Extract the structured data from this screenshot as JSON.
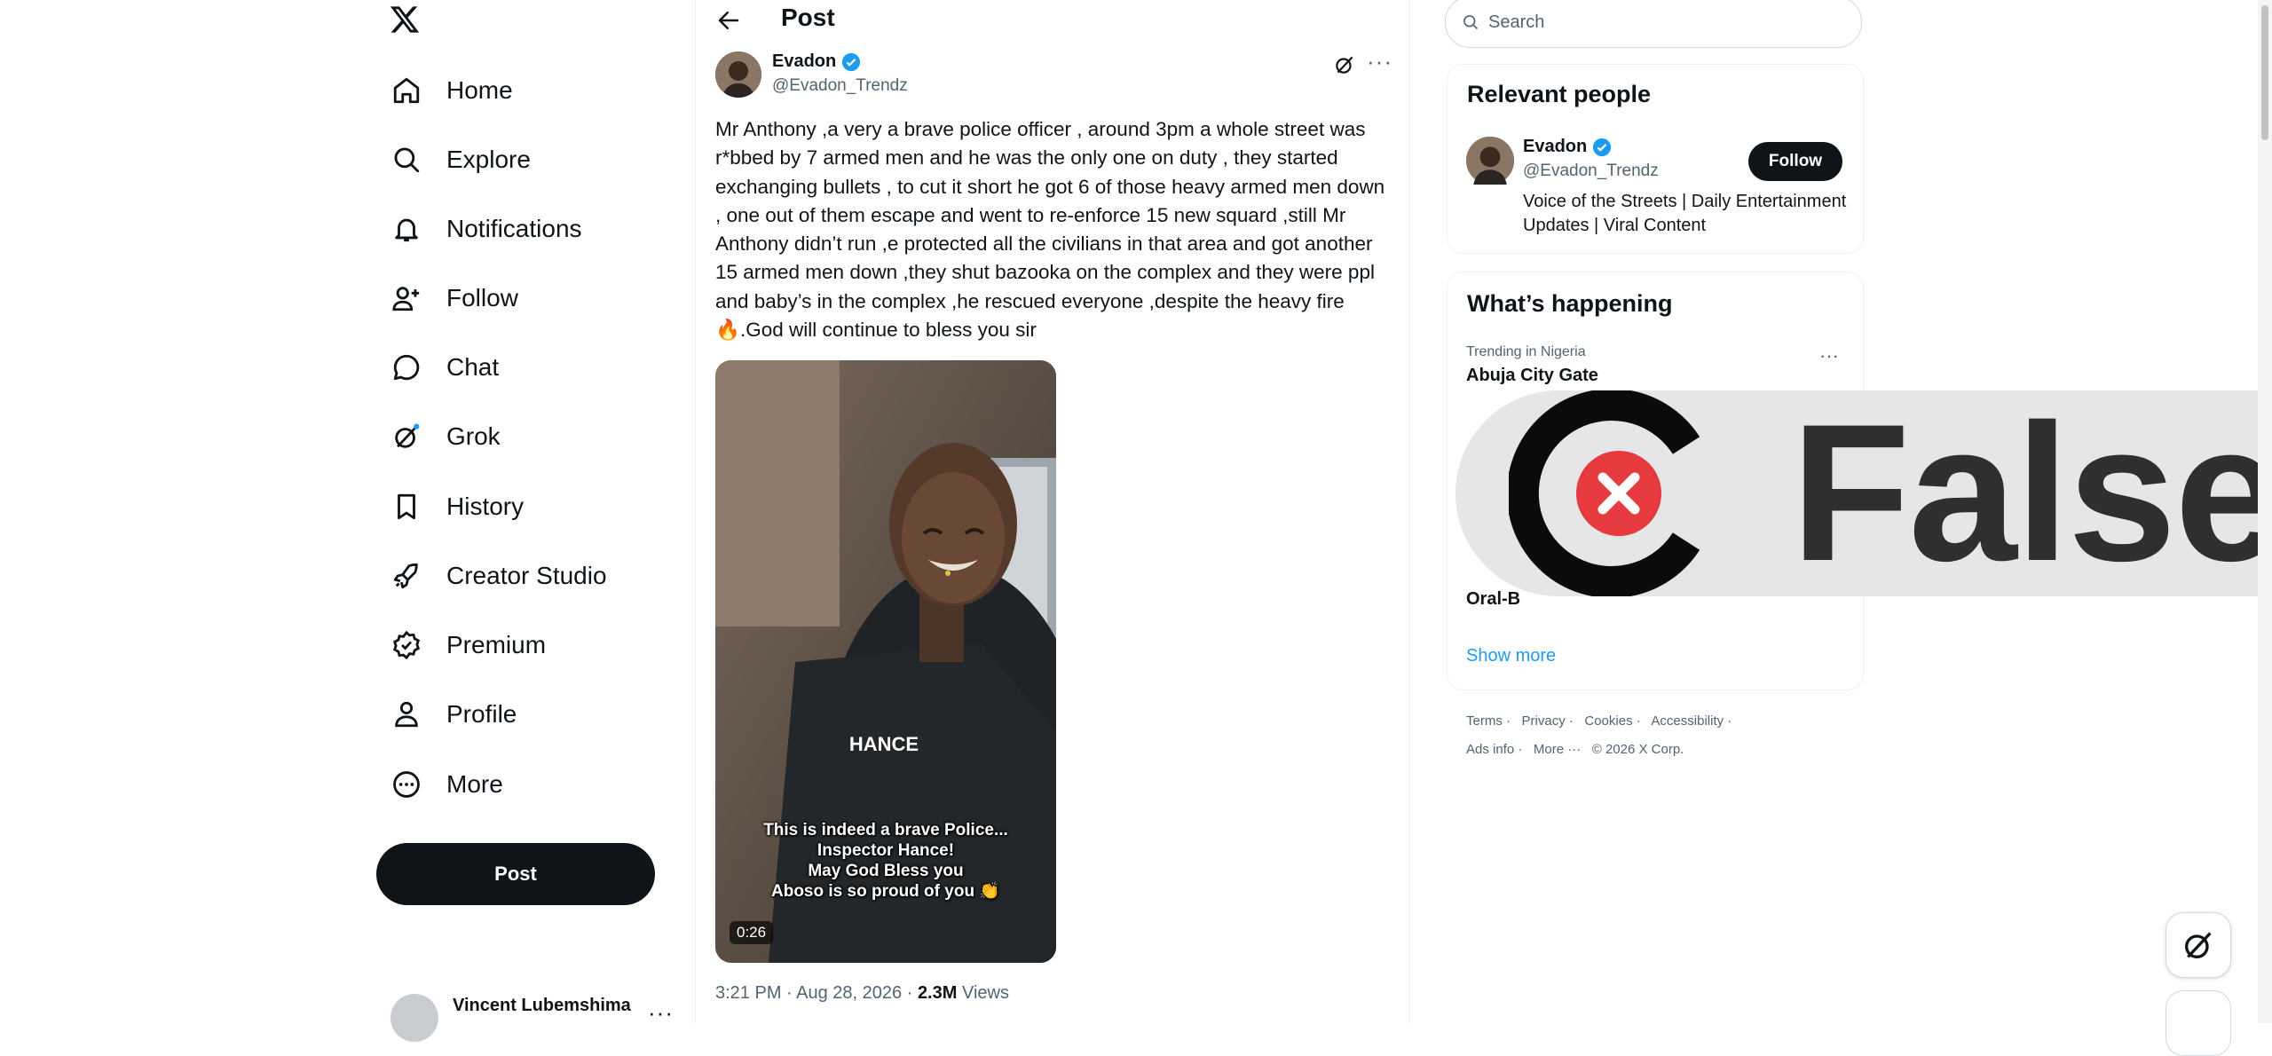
{
  "nav": {
    "items": [
      {
        "label": "Home",
        "icon": "home-icon"
      },
      {
        "label": "Explore",
        "icon": "search-icon"
      },
      {
        "label": "Notifications",
        "icon": "bell-icon"
      },
      {
        "label": "Follow",
        "icon": "person-plus-icon"
      },
      {
        "label": "Chat",
        "icon": "chat-bubble-icon"
      },
      {
        "label": "Grok",
        "icon": "grok-icon"
      },
      {
        "label": "History",
        "icon": "bookmark-icon"
      },
      {
        "label": "Creator Studio",
        "icon": "rocket-icon"
      },
      {
        "label": "Premium",
        "icon": "verified-badge-icon"
      },
      {
        "label": "Profile",
        "icon": "person-icon"
      },
      {
        "label": "More",
        "icon": "more-circle-icon"
      }
    ],
    "post_button": "Post",
    "account_name": "Vincent Lubemshima"
  },
  "post": {
    "header_title": "Post",
    "author_name": "Evadon",
    "author_handle": "@Evadon_Trendz",
    "text": "Mr Anthony ,a very a brave police officer , around 3pm a whole street was r*bbed by 7 armed men and he was the only one on duty , they started exchanging bullets , to cut it short he got 6 of those heavy armed men down , one out of them escape and went to re-enforce 15 new squard ,still Mr Anthony didn’t run ,e protected all the civilians in that area and got another 15 armed men down ,they shut bazooka on the complex and they were ppl and baby’s in the complex ,he rescued everyone ,despite the heavy fire 🔥.God will continue to bless you sir",
    "media": {
      "uniform_text": "HANCE",
      "caption_lines": [
        "This is indeed a brave Police...",
        "Inspector Hance!",
        "May God Bless you",
        "Aboso is so proud of you 👏"
      ],
      "duration": "0:26"
    },
    "time": "3:21 PM",
    "date": "Aug 28, 2026",
    "views_count": "2.3M",
    "views_label": "Views"
  },
  "sidebar": {
    "search_placeholder": "Search",
    "relevant_people_title": "Relevant people",
    "person": {
      "name": "Evadon",
      "handle": "@Evadon_Trendz",
      "bio": "Voice of the Streets | Daily Entertainment Updates | Viral Content",
      "follow_label": "Follow"
    },
    "whats_happening_title": "What’s happening",
    "trend_context": "Trending in Nigeria",
    "trend_name": "Abuja City Gate",
    "trend_name_2": "Oral-B",
    "show_more": "Show more",
    "footer_line1": [
      "Terms",
      "Privacy",
      "Cookies",
      "Accessibility"
    ],
    "footer_line2": [
      "Ads info",
      "More ···",
      "© 2026 X Corp."
    ]
  },
  "overlay": {
    "verdict": "False"
  },
  "colors": {
    "accent": "#1d9bf0",
    "text": "#0f1419",
    "muted": "#536471",
    "false_red": "#e63a3f"
  }
}
